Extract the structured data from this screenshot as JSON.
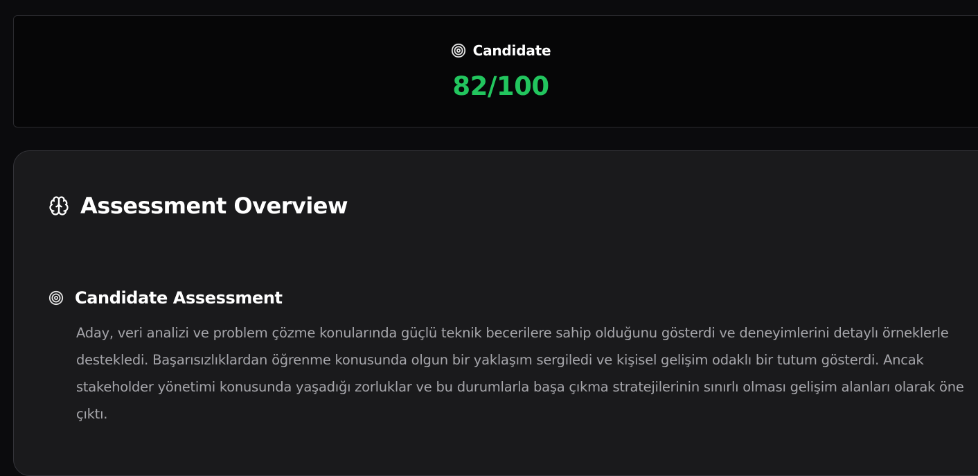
{
  "score": {
    "label": "Candidate",
    "value": "82/100",
    "icon": "target-icon",
    "value_color": "#22c55e"
  },
  "overview": {
    "title": "Assessment Overview",
    "icon": "brain-icon",
    "section": {
      "title": "Candidate Assessment",
      "icon": "target-icon",
      "body": "Aday, veri analizi ve problem çözme konularında güçlü teknik becerilere sahip olduğunu gösterdi ve deneyimlerini detaylı örneklerle destekledi. Başarısızlıklardan öğrenme konusunda olgun bir yaklaşım sergiledi ve kişisel gelişim odaklı bir tutum gösterdi. Ancak stakeholder yönetimi konusunda yaşadığı zorluklar ve bu durumlarla başa çıkma stratejilerinin sınırlı olması gelişim alanları olarak öne çıktı."
    }
  }
}
